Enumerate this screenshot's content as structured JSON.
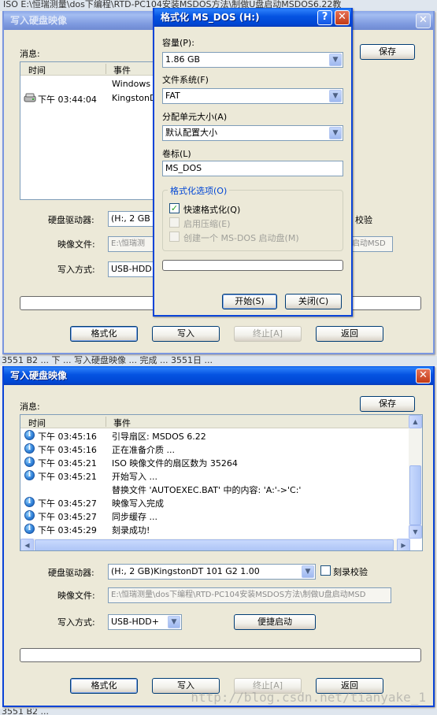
{
  "background": {
    "strip_top": "ISO    E:\\恒瑞测量\\dos下编程\\RTD-PC104安装MSDOS方法\\制做U盘启动MSDOS6.22教",
    "strip_mid": "3551 B2 ...  下 ...  写入硬盘映像 ... 完成 ... 3551日 ...",
    "strip_bottom": "3551 B2 ..."
  },
  "window1": {
    "title": "写入硬盘映像",
    "messages_label": "消息:",
    "save_button": "保存",
    "col_time": "时间",
    "col_event": "事件",
    "rows": [
      {
        "time": "",
        "event": "Windows X"
      },
      {
        "time": "下午 03:44:04",
        "event": "KingstonD"
      }
    ],
    "drive_label": "硬盘驱动器:",
    "drive_value": "(H:, 2 GB",
    "verify_label": "校验",
    "image_label": "映像文件:",
    "image_value": "E:\\恒瑞测",
    "image_value_tail": "启动MSD",
    "method_label": "写入方式:",
    "method_value": "USB-HDD+",
    "buttons": {
      "format": "格式化",
      "write": "写入",
      "stop": "终止[A]",
      "back": "返回"
    }
  },
  "format_dialog": {
    "title": "格式化 MS_DOS (H:)",
    "help_button": "?",
    "close_button": "✕",
    "capacity_label": "容量(P):",
    "capacity_value": "1.86 GB",
    "fs_label": "文件系统(F)",
    "fs_value": "FAT",
    "alloc_label": "分配单元大小(A)",
    "alloc_value": "默认配置大小",
    "volume_label": "卷标(L)",
    "volume_value": "MS_DOS",
    "options_title": "格式化选项(O)",
    "opt_quick": "快速格式化(Q)",
    "opt_compress": "启用压缩(E)",
    "opt_msdos": "创建一个 MS-DOS 启动盘(M)",
    "start_button": "开始(S)",
    "close_label": "关闭(C)"
  },
  "window2": {
    "title": "写入硬盘映像",
    "close_button": "✕",
    "messages_label": "消息:",
    "save_button": "保存",
    "col_time": "时间",
    "col_event": "事件",
    "rows": [
      {
        "icon": true,
        "time": "下午 03:45:16",
        "event": "引导扇区: MSDOS 6.22"
      },
      {
        "icon": true,
        "time": "下午 03:45:16",
        "event": "正在准备介质 ..."
      },
      {
        "icon": true,
        "time": "下午 03:45:21",
        "event": "ISO 映像文件的扇区数为 35264"
      },
      {
        "icon": true,
        "time": "下午 03:45:21",
        "event": "开始写入 ..."
      },
      {
        "icon": false,
        "time": "",
        "event": "替换文件 'AUTOEXEC.BAT' 中的内容: 'A:'->'C:'"
      },
      {
        "icon": true,
        "time": "下午 03:45:27",
        "event": "映像写入完成"
      },
      {
        "icon": true,
        "time": "下午 03:45:27",
        "event": "同步缓存 ..."
      },
      {
        "icon": true,
        "time": "下午 03:45:29",
        "event": "刻录成功!"
      }
    ],
    "drive_label": "硬盘驱动器:",
    "drive_value": "(H:, 2 GB)KingstonDT 101 G2         1.00",
    "verify_label": "刻录校验",
    "image_label": "映像文件:",
    "image_value": "E:\\恒瑞测量\\dos下编程\\RTD-PC104安装MSDOS方法\\制做U盘启动MSD",
    "method_label": "写入方式:",
    "method_value": "USB-HDD+",
    "quick_boot_button": "便捷启动",
    "buttons": {
      "format": "格式化",
      "write": "写入",
      "stop": "终止[A]",
      "back": "返回"
    }
  },
  "watermark": "http://blog.csdn.net/tianyake_1"
}
